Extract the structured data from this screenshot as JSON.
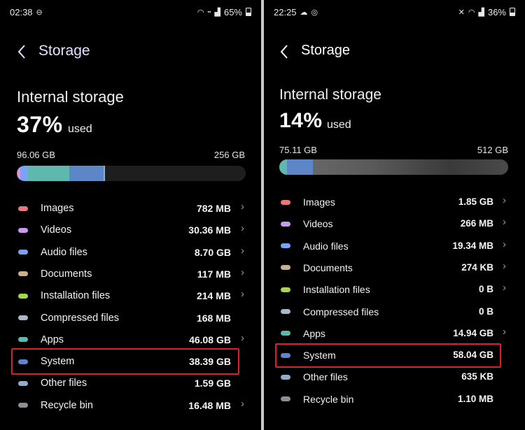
{
  "left": {
    "status": {
      "time": "02:38",
      "battery": "65%",
      "left_icons": [
        "minus-circle-icon"
      ],
      "right_icons": [
        "wifi-icon",
        "volte-icon",
        "signal-icon"
      ]
    },
    "header": {
      "title": "Storage"
    },
    "storage": {
      "heading": "Internal storage",
      "percent": "37%",
      "used_word": "used",
      "used": "96.06 GB",
      "total": "256 GB",
      "used_fraction": 0.37
    },
    "bar_segments": [
      {
        "name": "Images",
        "color": "#e9787a",
        "fraction": 0.003
      },
      {
        "name": "Videos",
        "color": "#c99bf0",
        "fraction": 0.012
      },
      {
        "name": "Audio files",
        "color": "#7aa3f5",
        "fraction": 0.034
      },
      {
        "name": "Apps",
        "color": "#5fb8ad",
        "fraction": 0.18
      },
      {
        "name": "System",
        "color": "#5d86c9",
        "fraction": 0.15
      },
      {
        "name": "Other files",
        "color": "#8eaec9",
        "fraction": 0.006
      }
    ],
    "items": [
      {
        "label": "Images",
        "size": "782 MB",
        "color": "#e9787a",
        "chevron": true
      },
      {
        "label": "Videos",
        "size": "30.36 MB",
        "color": "#c99bf0",
        "chevron": true
      },
      {
        "label": "Audio files",
        "size": "8.70 GB",
        "color": "#7aa3f5",
        "chevron": true
      },
      {
        "label": "Documents",
        "size": "117 MB",
        "color": "#cbb08d",
        "chevron": true
      },
      {
        "label": "Installation files",
        "size": "214 MB",
        "color": "#a7d64a",
        "chevron": true
      },
      {
        "label": "Compressed files",
        "size": "168 MB",
        "color": "#a9b8c7",
        "chevron": false
      },
      {
        "label": "Apps",
        "size": "46.08 GB",
        "color": "#5fb8ad",
        "chevron": true
      },
      {
        "label": "System",
        "size": "38.39 GB",
        "color": "#5d86c9",
        "chevron": false
      },
      {
        "label": "Other files",
        "size": "1.59 GB",
        "color": "#8eaec9",
        "chevron": false
      },
      {
        "label": "Recycle bin",
        "size": "16.48 MB",
        "color": "#8e8e96",
        "chevron": true
      }
    ],
    "highlight_color": "#d4232a"
  },
  "right": {
    "status": {
      "time": "22:25",
      "battery": "36%",
      "left_icons": [
        "cloud-icon",
        "target-icon"
      ],
      "right_icons": [
        "mute-icon",
        "wifi-icon",
        "signal-icon"
      ]
    },
    "header": {
      "title": "Storage"
    },
    "storage": {
      "heading": "Internal storage",
      "percent": "14%",
      "used_word": "used",
      "used": "75.11 GB",
      "total": "512 GB",
      "used_fraction": 0.14
    },
    "bar_segments": [
      {
        "name": "Images",
        "color": "#e9787a",
        "fraction": 0.004
      },
      {
        "name": "Apps",
        "color": "#5fb8ad",
        "fraction": 0.029
      },
      {
        "name": "System",
        "color": "#5d86c9",
        "fraction": 0.113
      }
    ],
    "items": [
      {
        "label": "Images",
        "size": "1.85 GB",
        "color": "#e9787a",
        "chevron": true
      },
      {
        "label": "Videos",
        "size": "266 MB",
        "color": "#c99bf0",
        "chevron": true
      },
      {
        "label": "Audio files",
        "size": "19.34 MB",
        "color": "#7aa3f5",
        "chevron": true
      },
      {
        "label": "Documents",
        "size": "274 KB",
        "color": "#cbb08d",
        "chevron": true
      },
      {
        "label": "Installation files",
        "size": "0 B",
        "color": "#a7d64a",
        "chevron": true
      },
      {
        "label": "Compressed files",
        "size": "0 B",
        "color": "#a9b8c7",
        "chevron": false
      },
      {
        "label": "Apps",
        "size": "14.94 GB",
        "color": "#5fb8ad",
        "chevron": true
      },
      {
        "label": "System",
        "size": "58.04 GB",
        "color": "#5d86c9",
        "chevron": false
      },
      {
        "label": "Other files",
        "size": "635 KB",
        "color": "#8eaec9",
        "chevron": false
      },
      {
        "label": "Recycle bin",
        "size": "1.10 MB",
        "color": "#8e8e96",
        "chevron": false
      }
    ],
    "highlight_color": "#d4232a"
  }
}
